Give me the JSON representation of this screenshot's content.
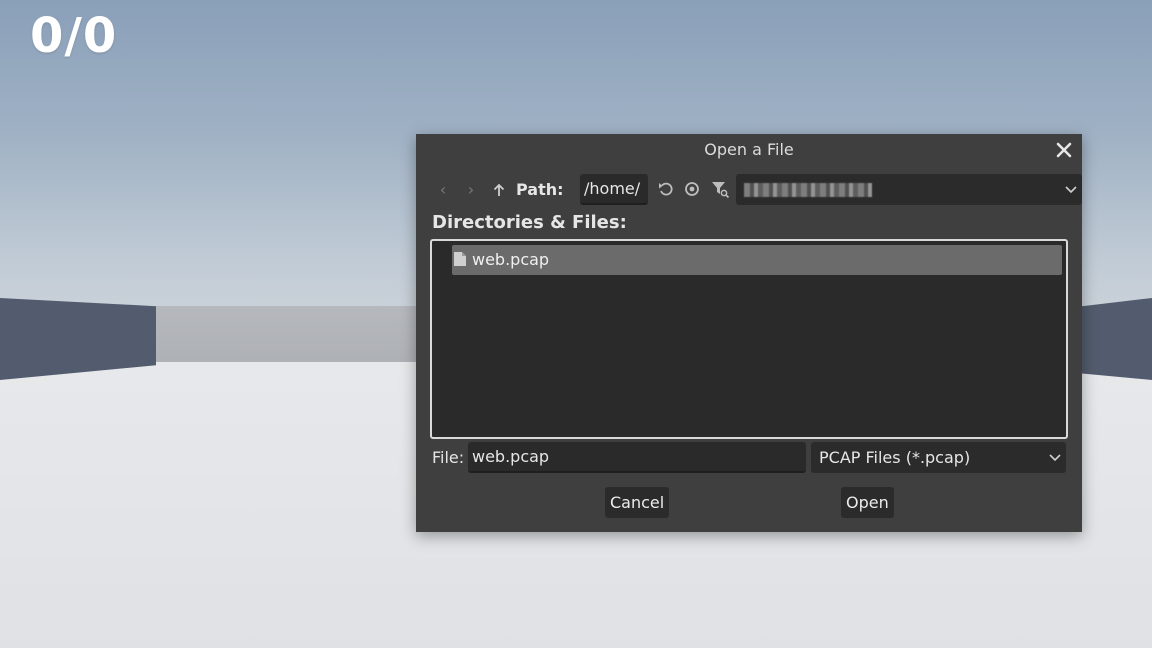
{
  "hud": {
    "score": "0/0"
  },
  "dialog": {
    "title": "Open a File",
    "path_label": "Path:",
    "path_value": "/home/",
    "section_label": "Directories & Files:",
    "files": [
      {
        "name": "web.pcap",
        "selected": true
      }
    ],
    "file_label": "File:",
    "file_value": "web.pcap",
    "filter_value": "PCAP Files (*.pcap)",
    "cancel_label": "Cancel",
    "open_label": "Open"
  },
  "colors": {
    "dialog_bg": "#3f3f3f",
    "input_bg": "#2a2a2a",
    "selected_row": "#6b6b6b",
    "wall": "#535c6e"
  }
}
